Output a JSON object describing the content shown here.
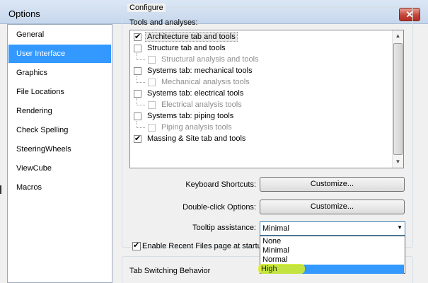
{
  "window": {
    "title": "Options",
    "close_label": "✕"
  },
  "nav": {
    "items": [
      {
        "label": "General",
        "selected": false
      },
      {
        "label": "User Interface",
        "selected": true
      },
      {
        "label": "Graphics",
        "selected": false
      },
      {
        "label": "File Locations",
        "selected": false
      },
      {
        "label": "Rendering",
        "selected": false
      },
      {
        "label": "Check Spelling",
        "selected": false
      },
      {
        "label": "SteeringWheels",
        "selected": false
      },
      {
        "label": "ViewCube",
        "selected": false
      },
      {
        "label": "Macros",
        "selected": false
      }
    ]
  },
  "configure": {
    "legend": "Configure",
    "tools_label": "Tools and analyses:",
    "tree": [
      {
        "label": "Architecture tab and tools",
        "checked": true,
        "level": 0,
        "enabled": true,
        "highlighted": true
      },
      {
        "label": "Structure tab and tools",
        "checked": false,
        "level": 0,
        "enabled": true
      },
      {
        "label": "Structural analysis and tools",
        "checked": false,
        "level": 1,
        "enabled": false
      },
      {
        "label": "Systems tab: mechanical tools",
        "checked": false,
        "level": 0,
        "enabled": true
      },
      {
        "label": "Mechanical analysis tools",
        "checked": false,
        "level": 1,
        "enabled": false
      },
      {
        "label": "Systems tab: electrical tools",
        "checked": false,
        "level": 0,
        "enabled": true
      },
      {
        "label": "Electrical analysis tools",
        "checked": false,
        "level": 1,
        "enabled": false
      },
      {
        "label": "Systems tab: piping tools",
        "checked": false,
        "level": 0,
        "enabled": true
      },
      {
        "label": "Piping analysis tools",
        "checked": false,
        "level": 1,
        "enabled": false
      },
      {
        "label": "Massing & Site tab and tools",
        "checked": true,
        "level": 0,
        "enabled": true
      }
    ],
    "keyboard_shortcuts": {
      "label": "Keyboard Shortcuts:",
      "button": "Customize..."
    },
    "double_click": {
      "label": "Double-click Options:",
      "button": "Customize..."
    },
    "tooltip": {
      "label": "Tooltip assistance:",
      "value": "Minimal",
      "options": [
        "None",
        "Minimal",
        "Normal",
        "High"
      ],
      "hovered": "High"
    },
    "recent_files": {
      "label": "Enable Recent Files page at startup",
      "checked": true
    }
  },
  "tab_switching": {
    "legend": "Tab Switching Behavior"
  },
  "colors": {
    "selection": "#3399ff",
    "highlighter": "#dcf01e"
  }
}
